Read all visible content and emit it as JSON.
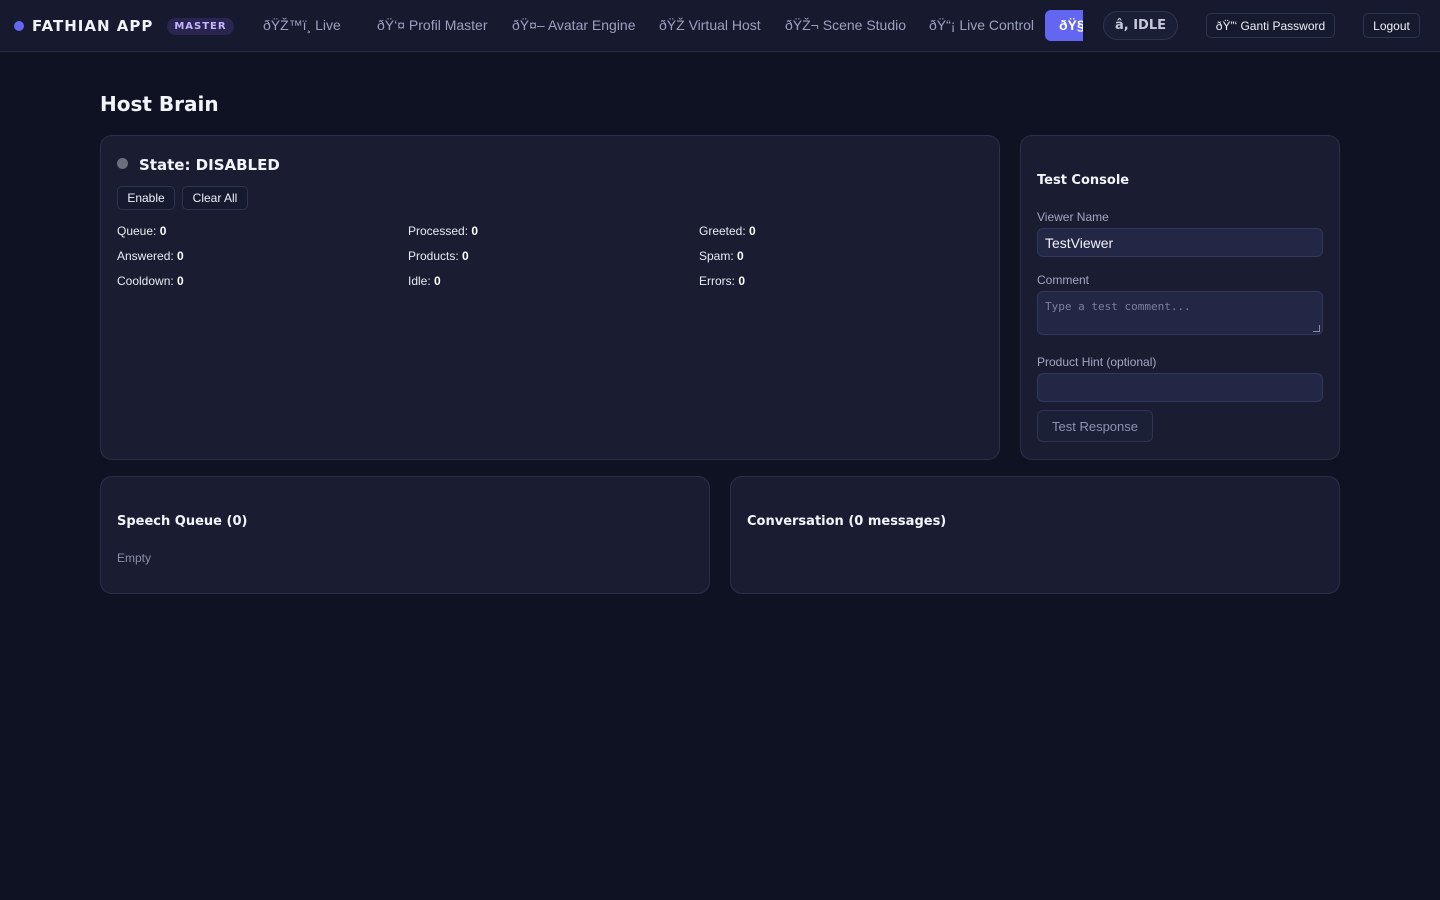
{
  "header": {
    "brand": "FATHIAN APP",
    "badge": "MASTER",
    "nav": [
      "ðŸŽ™ï¸ Live",
      "ðŸ‘¤ Profil Master",
      "ðŸ¤– Avatar Engine",
      "ðŸŽ­ Virtual Host",
      "ðŸŽ¬ Scene Studio",
      "ðŸ“¡ Live Control"
    ],
    "active_tab": "ðŸ§",
    "status": "â­, IDLE",
    "change_password": "ðŸ”‘ Ganti Password",
    "logout": "Logout"
  },
  "page": {
    "title": "Host Brain"
  },
  "brain": {
    "state_label": "State: DISABLED",
    "enable_label": "Enable",
    "clear_label": "Clear All",
    "stats": [
      {
        "label": "Queue:",
        "value": "0"
      },
      {
        "label": "Processed:",
        "value": "0"
      },
      {
        "label": "Greeted:",
        "value": "0"
      },
      {
        "label": "Answered:",
        "value": "0"
      },
      {
        "label": "Products:",
        "value": "0"
      },
      {
        "label": "Spam:",
        "value": "0"
      },
      {
        "label": "Cooldown:",
        "value": "0"
      },
      {
        "label": "Idle:",
        "value": "0"
      },
      {
        "label": "Errors:",
        "value": "0"
      }
    ]
  },
  "console": {
    "title": "Test Console",
    "viewer_label": "Viewer Name",
    "viewer_value": "TestViewer",
    "comment_label": "Comment",
    "comment_placeholder": "Type a test comment...",
    "hint_label": "Product Hint (optional)",
    "hint_value": "",
    "test_button": "Test Response"
  },
  "queue": {
    "title": "Speech Queue (0)",
    "empty": "Empty"
  },
  "conversation": {
    "title": "Conversation (0 messages)"
  },
  "colors": {
    "accent": "#6366f1",
    "background": "#0f1222",
    "card": "#1a1d32"
  }
}
